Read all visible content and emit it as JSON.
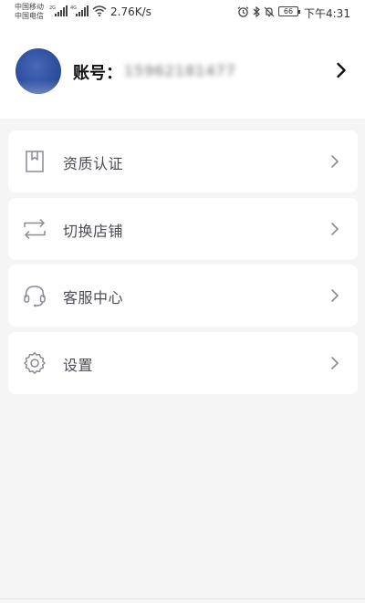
{
  "status_bar": {
    "carrier_1": "中国移动",
    "carrier_2": "中国电信",
    "net_1": "2G",
    "net_2": "4G",
    "speed": "2.76K/s",
    "battery": "66",
    "time": "下午4:31"
  },
  "account": {
    "label": "账号：",
    "value": "15962181477"
  },
  "menu": [
    {
      "label": "资质认证",
      "icon": "bookmark-icon"
    },
    {
      "label": "切换店铺",
      "icon": "switch-arrows-icon"
    },
    {
      "label": "客服中心",
      "icon": "headset-icon"
    },
    {
      "label": "设置",
      "icon": "gear-icon"
    }
  ],
  "colors": {
    "background": "#f5f5f6",
    "card": "#ffffff",
    "menu_text": "#4b4b55",
    "icon_stroke": "#8a8a95"
  }
}
